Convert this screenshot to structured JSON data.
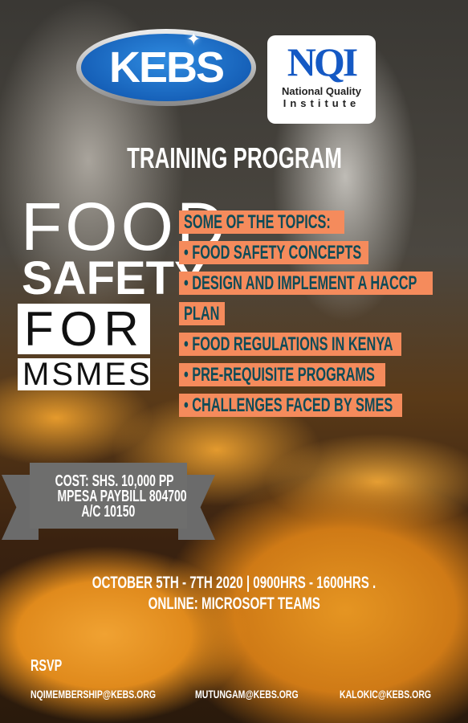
{
  "logos": {
    "kebs": "KEBS",
    "nqi": "NQI",
    "nqi_line1": "National Quality",
    "nqi_line2": "Institute"
  },
  "title": "TRAINING PROGRAM",
  "headline": {
    "food": "FOOD",
    "safety": "SAFETY",
    "for": "FOR",
    "msmes": "MSMES"
  },
  "topics": {
    "heading": "SOME OF THE TOPICS:",
    "items": [
      "• FOOD SAFETY CONCEPTS",
      "• DESIGN AND IMPLEMENT A HACCP",
      "PLAN",
      "• FOOD REGULATIONS IN KENYA",
      "• PRE-REQUISITE PROGRAMS",
      "• CHALLENGES FACED BY SMES"
    ]
  },
  "cost": {
    "line1": "COST: SHS. 10,000 PP",
    "line2": "MPESA PAYBILL 804700",
    "line3": "A/C 10150"
  },
  "event": {
    "dates": "OCTOBER 5TH - 7TH 2020 | 0900HRS - 1600HRS .",
    "venue": "ONLINE: MICROSOFT TEAMS"
  },
  "rsvp": {
    "label": "RSVP",
    "emails": [
      "NQIMEMBERSHIP@KEBS.ORG",
      "MUTUNGAM@KEBS.ORG",
      "KALOKIC@KEBS.ORG"
    ]
  },
  "colors": {
    "topic_bg": "#f58b5c",
    "topic_text": "#0f4b57",
    "banner": "#6e6e6d"
  }
}
